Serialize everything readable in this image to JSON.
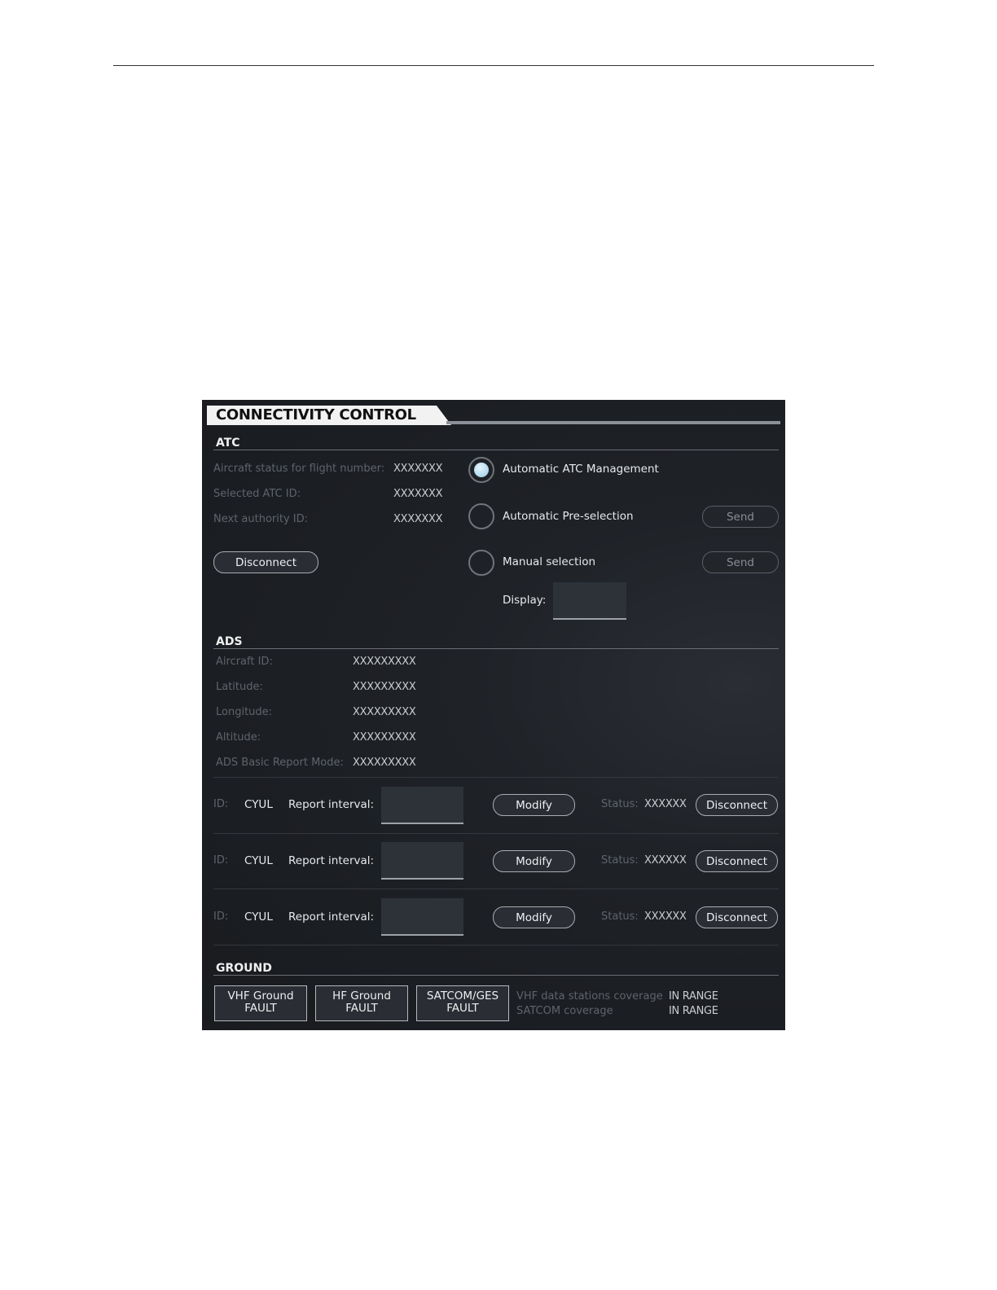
{
  "panel": {
    "title": "CONNECTIVITY CONTROL"
  },
  "atc": {
    "heading": "ATC",
    "rows": [
      {
        "label": "Aircraft status for flight number:",
        "value": "XXXXXXX"
      },
      {
        "label": "Selected ATC ID:",
        "value": "XXXXXXX"
      },
      {
        "label": "Next authority ID:",
        "value": "XXXXXXX"
      }
    ],
    "disconnect_label": "Disconnect",
    "options": [
      {
        "label": "Automatic ATC Management",
        "selected": true
      },
      {
        "label": "Automatic Pre-selection",
        "selected": false,
        "send_label": "Send"
      },
      {
        "label": "Manual selection",
        "selected": false,
        "send_label": "Send"
      }
    ],
    "display_label": "Display:"
  },
  "ads": {
    "heading": "ADS",
    "rows": [
      {
        "label": "Aircraft ID:",
        "value": "XXXXXXXXX"
      },
      {
        "label": "Latitude:",
        "value": "XXXXXXXXX"
      },
      {
        "label": "Longitude:",
        "value": "XXXXXXXXX"
      },
      {
        "label": "Altitude:",
        "value": "XXXXXXXXX"
      },
      {
        "label": "ADS Basic Report Mode:",
        "value": "XXXXXXXXX"
      }
    ],
    "contracts": [
      {
        "id_label": "ID:",
        "id": "CYUL",
        "interval_label": "Report interval:",
        "modify_label": "Modify",
        "status_label": "Status:",
        "status": "XXXXXX",
        "disconnect_label": "Disconnect"
      },
      {
        "id_label": "ID:",
        "id": "CYUL",
        "interval_label": "Report interval:",
        "modify_label": "Modify",
        "status_label": "Status:",
        "status": "XXXXXX",
        "disconnect_label": "Disconnect"
      },
      {
        "id_label": "ID:",
        "id": "CYUL",
        "interval_label": "Report interval:",
        "modify_label": "Modify",
        "status_label": "Status:",
        "status": "XXXXXX",
        "disconnect_label": "Disconnect"
      }
    ]
  },
  "ground": {
    "heading": "GROUND",
    "faults": [
      {
        "line1": "VHF Ground",
        "line2": "FAULT"
      },
      {
        "line1": "HF Ground",
        "line2": "FAULT"
      },
      {
        "line1": "SATCOM/GES",
        "line2": "FAULT"
      }
    ],
    "coverage": [
      {
        "label": "VHF data stations coverage",
        "value": "IN RANGE"
      },
      {
        "label": "SATCOM coverage",
        "value": "IN RANGE"
      }
    ]
  },
  "colors": {
    "selected_radio": "#b6dcef",
    "panel_bg": "#1c1f23"
  }
}
